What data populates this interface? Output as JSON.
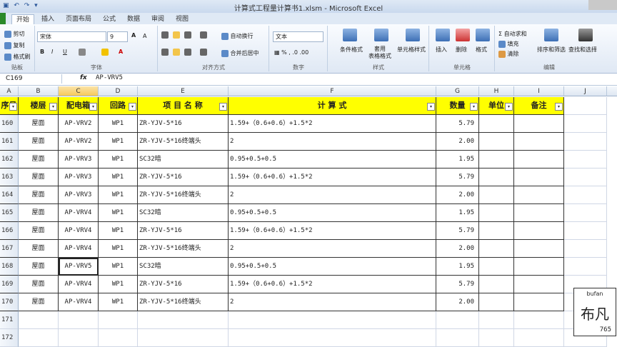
{
  "window": {
    "title": "计算式工程量计算书1.xlsm - Microsoft Excel"
  },
  "tabs": [
    "开始",
    "插入",
    "页面布局",
    "公式",
    "数据",
    "审阅",
    "视图"
  ],
  "ribbon": {
    "clipboard": {
      "cut": "剪切",
      "copy": "复制",
      "format_painter": "格式刷",
      "label": "贴板"
    },
    "font": {
      "name": "宋体",
      "size": "9",
      "label": "字体",
      "bold": "B",
      "italic": "I",
      "underline": "U",
      "grow": "A",
      "shrink": "A"
    },
    "alignment": {
      "wrap": "自动换行",
      "merge": "合并后居中",
      "label": "对齐方式"
    },
    "number": {
      "format": "文本",
      "label": "数字"
    },
    "styles": {
      "conditional": "条件格式",
      "table": "套用\n表格格式",
      "cell": "单元格样式",
      "label": "样式"
    },
    "cells": {
      "insert": "插入",
      "delete": "删除",
      "format": "格式",
      "label": "单元格"
    },
    "editing": {
      "autosum": "Σ 自动求和",
      "fill": "填充",
      "clear": "清除",
      "sort": "排序和筛选",
      "find": "查找和选择",
      "label": "编辑"
    }
  },
  "formula_bar": {
    "name_box": "C169",
    "fx": "fx",
    "value": "AP-VRV5"
  },
  "columns": [
    "A",
    "B",
    "C",
    "D",
    "E",
    "F",
    "G",
    "H",
    "I",
    "J"
  ],
  "selected_column": "C",
  "header_row": [
    "序号",
    "楼层",
    "配电箱",
    "回路",
    "项 目 名 称",
    "计  算  式",
    "数量",
    "单位",
    "备注"
  ],
  "rows": [
    {
      "num": "160",
      "floor": "屋面",
      "box": "AP-VRV2",
      "circuit": "WP1",
      "item": "ZR-YJV-5*16",
      "formula": "1.59+（0.6+0.6）+1.5*2",
      "qty": "5.79"
    },
    {
      "num": "161",
      "floor": "屋面",
      "box": "AP-VRV2",
      "circuit": "WP1",
      "item": "ZR-YJV-5*16终端头",
      "formula": "2",
      "qty": "2.00"
    },
    {
      "num": "162",
      "floor": "屋面",
      "box": "AP-VRV3",
      "circuit": "WP1",
      "item": "SC32暗",
      "formula": "0.95+0.5+0.5",
      "qty": "1.95"
    },
    {
      "num": "163",
      "floor": "屋面",
      "box": "AP-VRV3",
      "circuit": "WP1",
      "item": "ZR-YJV-5*16",
      "formula": "1.59+（0.6+0.6）+1.5*2",
      "qty": "5.79"
    },
    {
      "num": "164",
      "floor": "屋面",
      "box": "AP-VRV3",
      "circuit": "WP1",
      "item": "ZR-YJV-5*16终端头",
      "formula": "2",
      "qty": "2.00"
    },
    {
      "num": "165",
      "floor": "屋面",
      "box": "AP-VRV4",
      "circuit": "WP1",
      "item": "SC32暗",
      "formula": "0.95+0.5+0.5",
      "qty": "1.95"
    },
    {
      "num": "166",
      "floor": "屋面",
      "box": "AP-VRV4",
      "circuit": "WP1",
      "item": "ZR-YJV-5*16",
      "formula": "1.59+（0.6+0.6）+1.5*2",
      "qty": "5.79"
    },
    {
      "num": "167",
      "floor": "屋面",
      "box": "AP-VRV4",
      "circuit": "WP1",
      "item": "ZR-YJV-5*16终端头",
      "formula": "2",
      "qty": "2.00"
    },
    {
      "num": "168",
      "floor": "屋面",
      "box": "AP-VRV5",
      "circuit": "WP1",
      "item": "SC32暗",
      "formula": "0.95+0.5+0.5",
      "qty": "1.95"
    },
    {
      "num": "169",
      "floor": "屋面",
      "box": "AP-VRV4",
      "circuit": "WP1",
      "item": "ZR-YJV-5*16",
      "formula": "1.59+（0.6+0.6）+1.5*2",
      "qty": "5.79"
    },
    {
      "num": "170",
      "floor": "屋面",
      "box": "AP-VRV4",
      "circuit": "WP1",
      "item": "ZR-YJV-5*16终端头",
      "formula": "2",
      "qty": "2.00"
    }
  ],
  "empty_rows": [
    "171",
    "172"
  ],
  "watermark": {
    "top": "bufan",
    "middle": "布凡",
    "bottom": "765"
  },
  "colors": {
    "header_fill": "#ffff00",
    "file_tab": "#2a8a2a",
    "selected_col": "#f6c95a"
  }
}
